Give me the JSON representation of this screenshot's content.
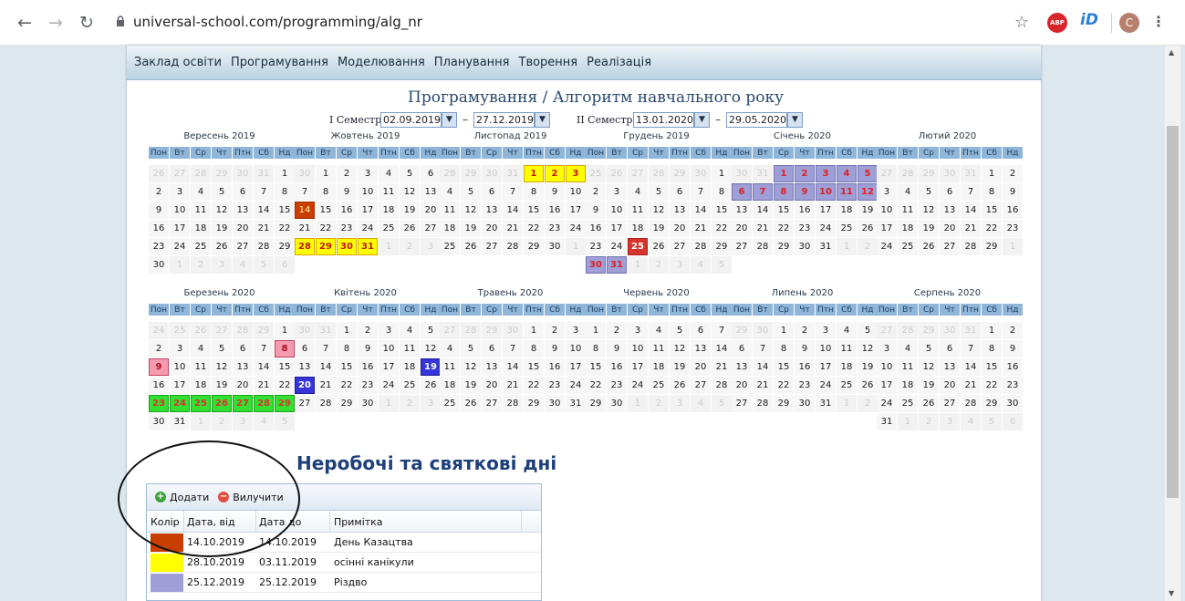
{
  "browser": {
    "url": "universal-school.com/programming/alg_nr",
    "avatar_letter": "C",
    "ext_abp": "ABP",
    "ext_id": "iD"
  },
  "menu": [
    "Заклад освіти",
    "Програмування",
    "Моделювання",
    "Планування",
    "Творення",
    "Реалізація"
  ],
  "title": "Програмування / Алгоритм навчального року",
  "semesters": {
    "s1_label": "I Семестр",
    "s1_from": "02.09.2019",
    "s1_to": "27.12.2019",
    "s2_label": "II Семестр",
    "s2_from": "13.01.2020",
    "s2_to": "29.05.2020"
  },
  "weekdays": [
    "Пон",
    "Вт",
    "Ср",
    "Чт",
    "Птн",
    "Сб",
    "Нд"
  ],
  "months": [
    {
      "title": "Вересень 2019",
      "prev_days": 6,
      "days": 30,
      "marks": {}
    },
    {
      "title": "Жовтень 2019",
      "prev_days": 1,
      "days": 31,
      "marks": {
        "14": "br",
        "28": "y",
        "29": "y",
        "30": "y",
        "31": "y"
      }
    },
    {
      "title": "Листопад 2019",
      "prev_days": 4,
      "days": 30,
      "marks": {
        "1": "y",
        "2": "y",
        "3": "y"
      }
    },
    {
      "title": "Грудень 2019",
      "prev_days": 6,
      "days": 31,
      "marks": {
        "25": "dr",
        "30": "lv",
        "31": "lv"
      }
    },
    {
      "title": "Січень 2020",
      "prev_days": 2,
      "days": 31,
      "marks": {
        "1": "lv",
        "2": "lv",
        "3": "lv",
        "4": "lv",
        "5": "lv",
        "6": "lv",
        "7": "lv",
        "8": "lv",
        "9": "lv",
        "10": "lv",
        "11": "lv",
        "12": "lv"
      }
    },
    {
      "title": "Лютий 2020",
      "prev_days": 5,
      "days": 29,
      "marks": {}
    },
    {
      "title": "Березень 2020",
      "prev_days": 6,
      "days": 31,
      "marks": {
        "8": "p",
        "9": "p",
        "23": "g",
        "24": "g",
        "25": "g",
        "26": "g",
        "27": "g",
        "28": "g",
        "29": "g"
      }
    },
    {
      "title": "Квітень 2020",
      "prev_days": 2,
      "days": 30,
      "marks": {
        "19": "bl",
        "20": "bl"
      }
    },
    {
      "title": "Травень 2020",
      "prev_days": 4,
      "days": 31,
      "marks": {}
    },
    {
      "title": "Червень 2020",
      "prev_days": 0,
      "days": 30,
      "marks": {}
    },
    {
      "title": "Липень 2020",
      "prev_days": 2,
      "days": 31,
      "marks": {}
    },
    {
      "title": "Серпень 2020",
      "prev_days": 5,
      "days": 31,
      "marks": {}
    }
  ],
  "holidays": {
    "section_title": "Неробочі та святкові дні",
    "add_label": "Додати",
    "remove_label": "Вилучити",
    "columns": [
      "Колір",
      "Дата, від",
      "Дата до",
      "Примітка"
    ],
    "rows": [
      {
        "color": "#c73e00",
        "from": "14.10.2019",
        "to": "14.10.2019",
        "note": "День Казацтва"
      },
      {
        "color": "#ffff00",
        "from": "28.10.2019",
        "to": "03.11.2019",
        "note": "осінні канікули"
      },
      {
        "color": "#9e9fd6",
        "from": "25.12.2019",
        "to": "25.12.2019",
        "note": "Різдво"
      }
    ]
  }
}
